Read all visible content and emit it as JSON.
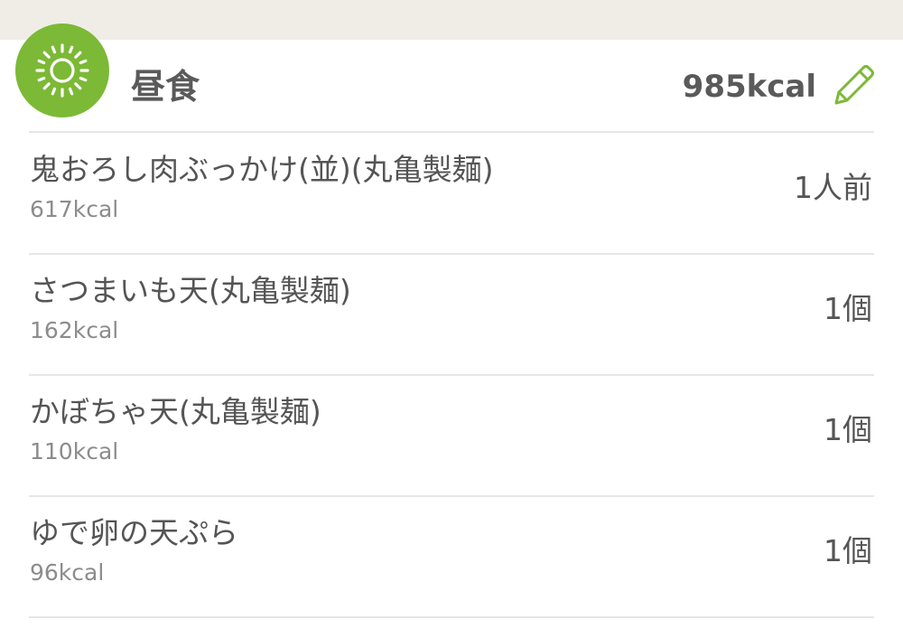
{
  "meal": {
    "title": "昼食",
    "total_kcal": "985kcal",
    "icon": "sun-icon",
    "edit_icon": "pencil-icon",
    "accent_color": "#7cb936"
  },
  "items": [
    {
      "name": "鬼おろし肉ぶっかけ(並)(丸亀製麺)",
      "kcal": "617kcal",
      "quantity": "1人前"
    },
    {
      "name": "さつまいも天(丸亀製麺)",
      "kcal": "162kcal",
      "quantity": "1個"
    },
    {
      "name": "かぼちゃ天(丸亀製麺)",
      "kcal": "110kcal",
      "quantity": "1個"
    },
    {
      "name": "ゆで卵の天ぷら",
      "kcal": "96kcal",
      "quantity": "1個"
    }
  ]
}
